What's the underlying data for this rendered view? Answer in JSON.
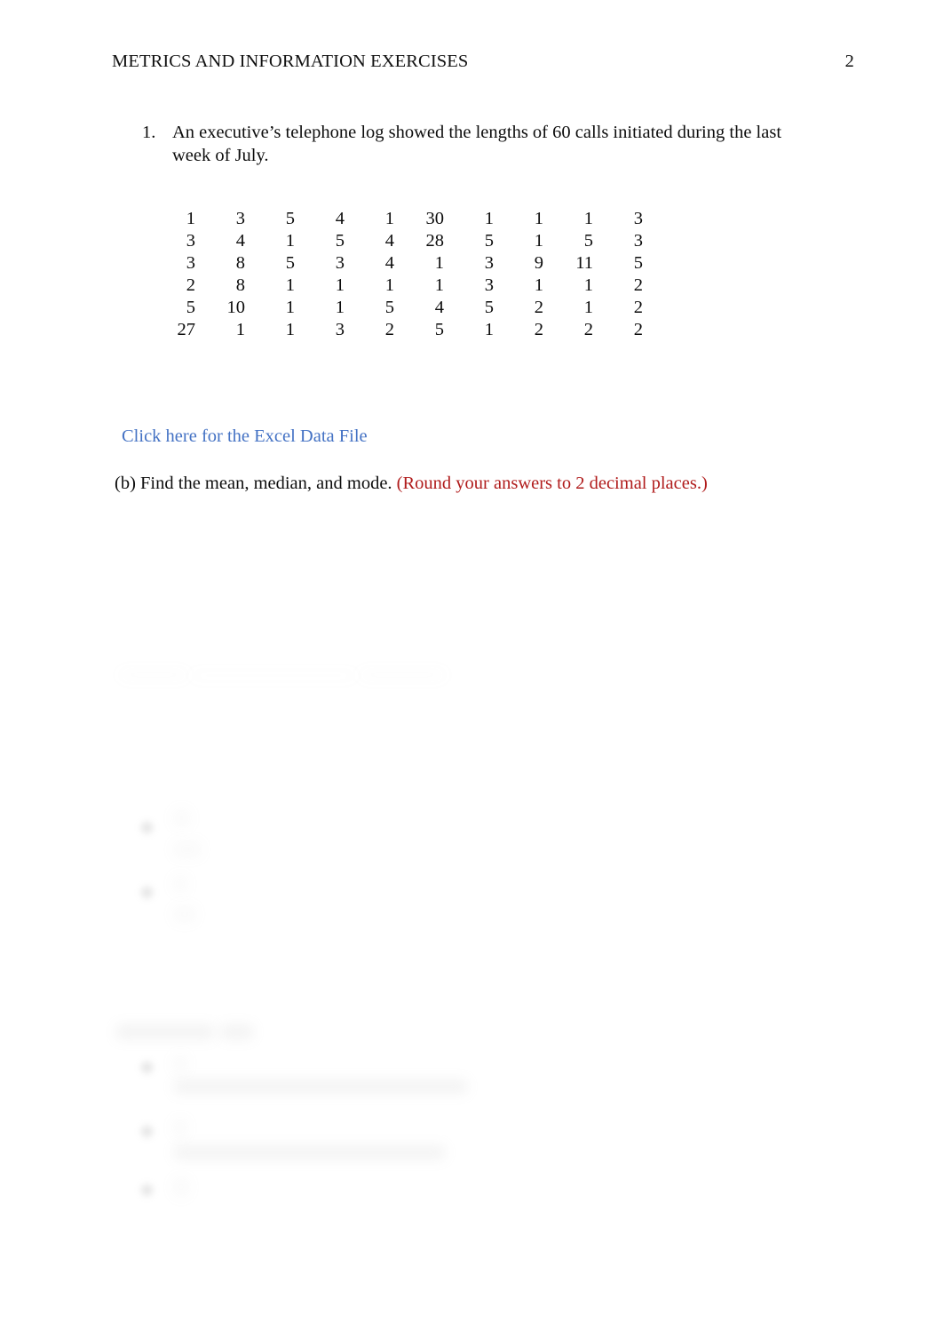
{
  "header": {
    "title": "METRICS AND INFORMATION EXERCISES",
    "page_number": "2"
  },
  "question": {
    "number": "1.",
    "text": "An executive’s telephone log showed the lengths of 60 calls initiated during the last week of July."
  },
  "data_table": {
    "rows": [
      [
        "1",
        "3",
        "5",
        "4",
        "1",
        "30",
        "1",
        "1",
        "1",
        "3"
      ],
      [
        "3",
        "4",
        "1",
        "5",
        "4",
        "28",
        "5",
        "1",
        "5",
        "3"
      ],
      [
        "3",
        "8",
        "5",
        "3",
        "4",
        "1",
        "3",
        "9",
        "11",
        "5"
      ],
      [
        "2",
        "8",
        "1",
        "1",
        "1",
        "1",
        "3",
        "1",
        "1",
        "2"
      ],
      [
        "5",
        "10",
        "1",
        "1",
        "5",
        "4",
        "5",
        "2",
        "1",
        "2"
      ],
      [
        "27",
        "1",
        "1",
        "3",
        "2",
        "5",
        "1",
        "2",
        "2",
        "2"
      ]
    ]
  },
  "excel_link": {
    "label": "Click here for the Excel Data File",
    "color": "#4472c4"
  },
  "part_b": {
    "prompt": "(b) Find the mean, median, and mode.",
    "round_note": "(Round your answers to 2 decimal places.)",
    "note_color": "#b01b1b"
  },
  "obscured": {
    "description": "Lower portion of the page is blurred and illegible"
  }
}
